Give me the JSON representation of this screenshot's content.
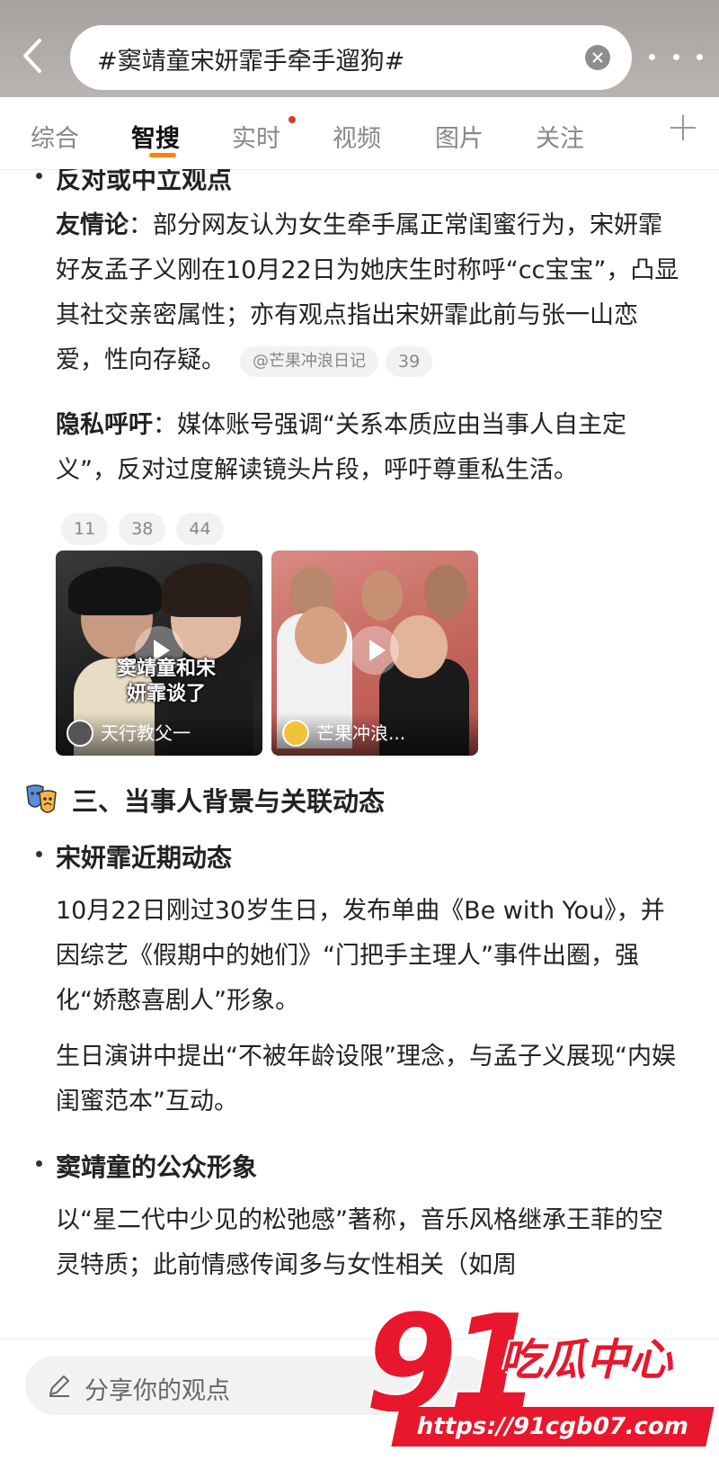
{
  "topbar": {
    "search_text": "#窦靖童宋妍霏手牵手遛狗#",
    "back_icon": "chevron-left-icon",
    "clear_icon": "close-circle-icon",
    "more_icon": "more-horizontal-icon"
  },
  "tabs": [
    {
      "label": "综合"
    },
    {
      "label": "智搜",
      "active": true
    },
    {
      "label": "实时",
      "has_dot": true
    },
    {
      "label": "视频"
    },
    {
      "label": "图片"
    },
    {
      "label": "关注"
    }
  ],
  "content": {
    "partial_heading": "反对或中立观点",
    "friendship": {
      "label": "友情论",
      "text": "：部分网友认为女生牵手属正常闺蜜行为，宋妍霏好友孟子义刚在10月22日为她庆生时称呼“cc宝宝”，凸显其社交亲密属性；亦有观点指出宋妍霏此前与张一山恋爱，性向存疑。",
      "cite_source": "@芒果冲浪日记",
      "cite_num": "39"
    },
    "privacy": {
      "label": "隐私呼吁",
      "text": "：媒体账号强调“关系本质应由当事人自主定义”，反对过度解读镜头片段，呼吁尊重私生活。"
    },
    "refs": [
      "11",
      "38",
      "44"
    ],
    "videos": [
      {
        "overlay": "窦靖童和宋妍霏谈了",
        "author": "天行教父一"
      },
      {
        "overlay": "",
        "author": "芒果冲浪..."
      }
    ],
    "section3_title": "三、当事人背景与关联动态",
    "song": {
      "heading": "宋妍霏近期动态",
      "p1": "10月22日刚过30岁生日，发布单曲《Be with You》，并因综艺《假期中的她们》“门把手主理人”事件出圈，强化“娇憨喜剧人”形象。",
      "p2": "生日演讲中提出“不被年龄设限”理念，与孟子义展现“内娱闺蜜范本”互动。"
    },
    "dou": {
      "heading": "窦靖童的公众形象",
      "p1": "以“星二代中少见的松弛感”著称，音乐风格继承王菲的空灵特质；此前情感传闻多与女性相关（如周"
    }
  },
  "bottombar": {
    "placeholder": "分享你的观点",
    "pen_icon": "pencil-icon"
  },
  "watermark": {
    "num": "91",
    "cn": "吃瓜中心",
    "url": "https://91cgb07.com"
  },
  "colors": {
    "accent": "#ff8200",
    "watermark_red": "#e8172d"
  }
}
